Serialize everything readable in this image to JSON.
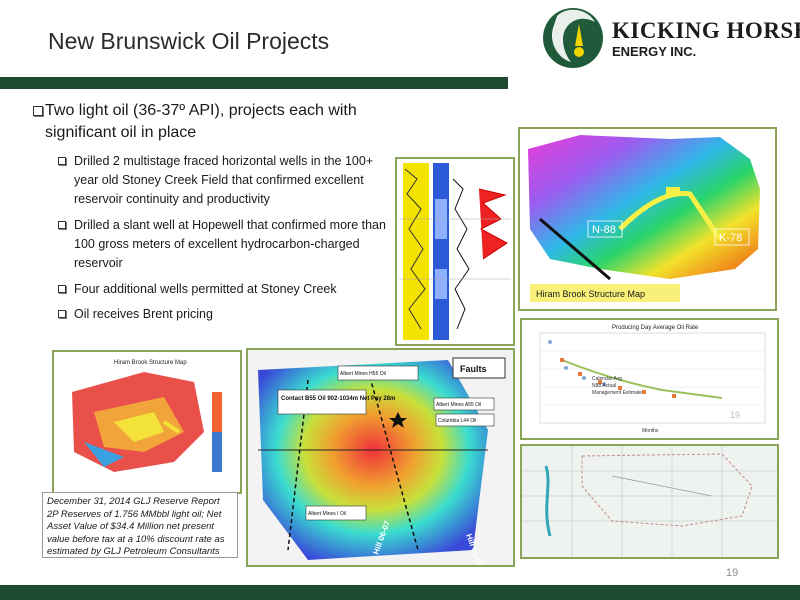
{
  "header": {
    "title": "New Brunswick Oil Projects",
    "logo_line1": "KICKING HORSE",
    "logo_line2": "ENERGY INC."
  },
  "main_bullet": "Two light oil (36-37º API), projects each with significant oil in place",
  "sub_bullets": [
    "Drilled 2 multistage fraced horizontal wells in the 100+ year old Stoney Creek Field that confirmed excellent reservoir continuity and productivity",
    "Drilled a slant well at Hopewell that confirmed more than 100 gross meters of excellent hydrocarbon-charged reservoir",
    "Four additional wells permitted at Stoney Creek",
    "Oil receives Brent pricing"
  ],
  "hiram_map": {
    "caption": "Hiram Brook Structure Map",
    "well_left": "N-88",
    "well_right": "K-78"
  },
  "small_map": {
    "title": "Hiram Brook Structure Map"
  },
  "faults_map": {
    "legend": "Faults",
    "callouts": [
      "Contact B55  Oil  902-1034m  Net Pay  28m",
      "Albert Mines H55  Oil",
      "Albert Mines A55  Oil",
      "Columbia L44 Oil",
      "Albert Mines I  Oil"
    ],
    "wells": [
      "Hill 06-07",
      "Hill 06-06"
    ]
  },
  "production_chart": {
    "title": "Producing Day Average Oil Rate",
    "legend": [
      "Calendar Avg",
      "N88 Actual",
      "Management Estimate"
    ],
    "xlabel": "Months",
    "page_marker": "19"
  },
  "reserve_note": "December 31, 2014 GLJ Reserve Report 2P Reserves of 1.756 MMbbl light oil; Net Asset Value of $34.4 Million net present value before tax at a 10% discount rate as estimated by GLJ Petroleum Consultants",
  "footer": {
    "page_number": "19"
  },
  "colors": {
    "bar": "#1d4a31",
    "frame": "#8aa55a",
    "logo_green": "#1f5a3a"
  }
}
